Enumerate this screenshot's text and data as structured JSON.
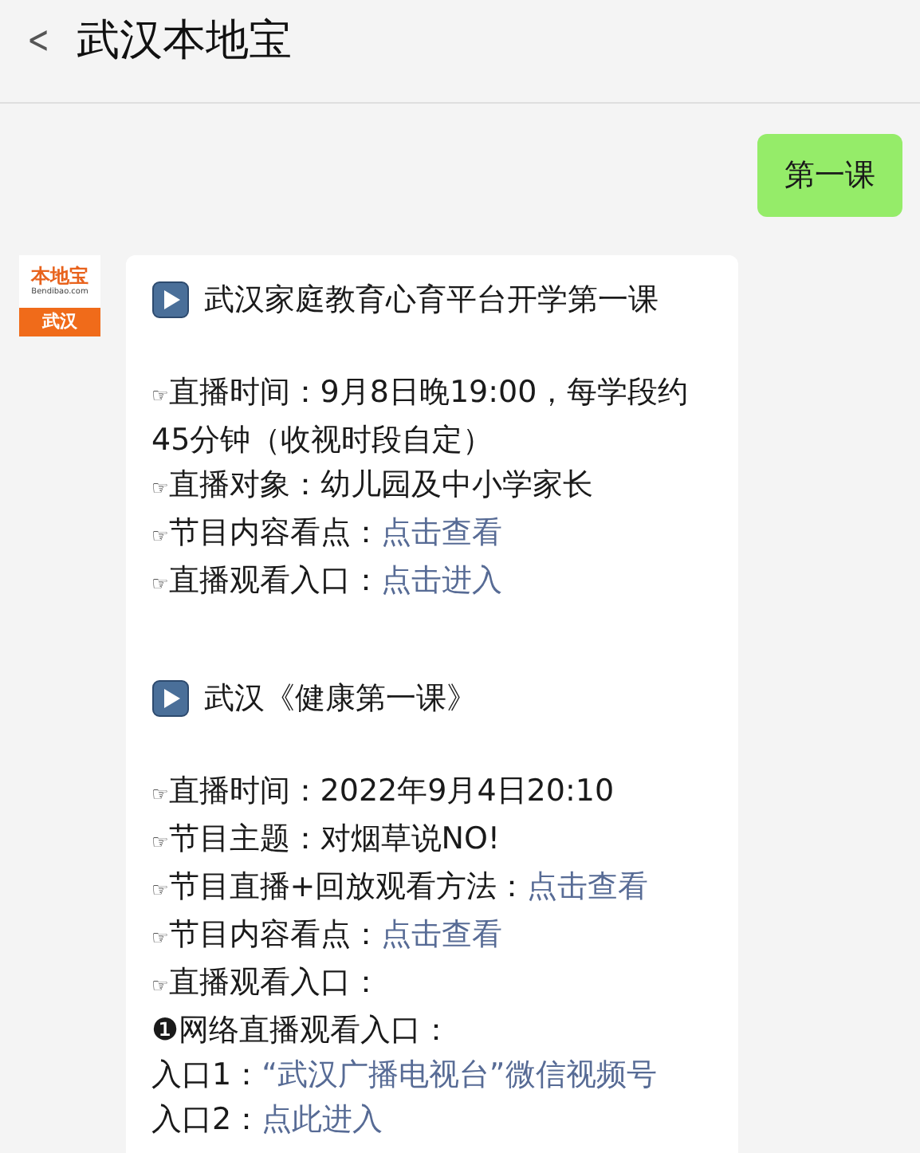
{
  "header": {
    "back": "<",
    "title": "武汉本地宝"
  },
  "messages": [
    {
      "kind": "outgoing",
      "text": "第一课"
    },
    {
      "kind": "incoming",
      "avatar": {
        "brand": "本地宝",
        "domain": "Bendibao.com",
        "city": "武汉"
      },
      "blocks": [
        {
          "kind": "heading",
          "text": "武汉家庭教育心育平台开学第一课"
        },
        {
          "kind": "line",
          "bullet": "☞",
          "text": "直播时间：9月8日晚19:00，每学段约45分钟（收视时段自定）"
        },
        {
          "kind": "line",
          "bullet": "☞",
          "text": "直播对象：幼儿园及中小学家长"
        },
        {
          "kind": "line",
          "bullet": "☞",
          "text": "节目内容看点：",
          "link": "点击查看"
        },
        {
          "kind": "line",
          "bullet": "☞",
          "text": "直播观看入口：",
          "link": "点击进入"
        },
        {
          "kind": "heading",
          "text": "武汉《健康第一课》"
        },
        {
          "kind": "line",
          "bullet": "☞",
          "text": "直播时间：2022年9月4日20:10"
        },
        {
          "kind": "line",
          "bullet": "☞",
          "text": "节目主题：对烟草说NO!"
        },
        {
          "kind": "line",
          "bullet": "☞",
          "text": "节目直播+回放观看方法：",
          "link": "点击查看"
        },
        {
          "kind": "line",
          "bullet": "☞",
          "text": "节目内容看点：",
          "link": "点击查看"
        },
        {
          "kind": "line",
          "bullet": "☞",
          "text": "直播观看入口："
        },
        {
          "kind": "line",
          "bullet": "❶",
          "text": "网络直播观看入口："
        },
        {
          "kind": "line",
          "text": "入口1：",
          "link": "“武汉广播电视台”微信视频号"
        },
        {
          "kind": "line",
          "text": "入口2：",
          "link": "点此进入"
        }
      ]
    }
  ]
}
